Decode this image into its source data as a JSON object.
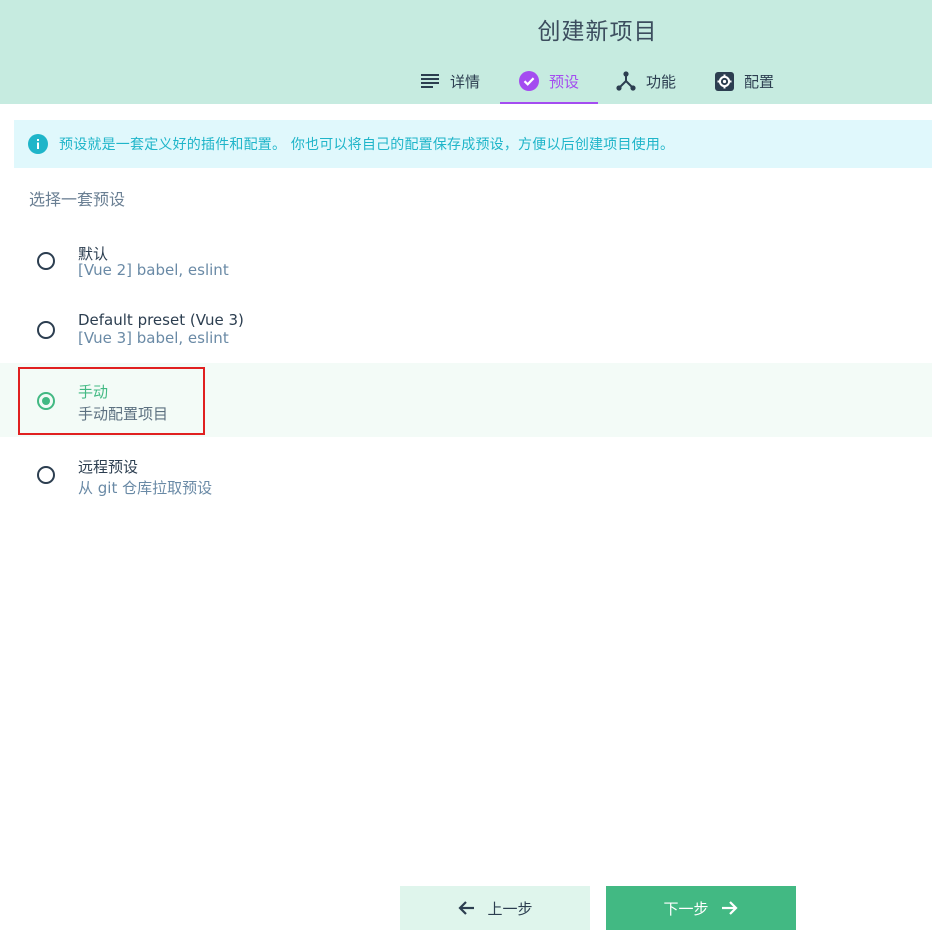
{
  "header": {
    "title": "创建新项目",
    "tabs": [
      {
        "label": "详情",
        "icon": "list-icon"
      },
      {
        "label": "预设",
        "icon": "check-circle-icon",
        "active": true
      },
      {
        "label": "功能",
        "icon": "fork-icon"
      },
      {
        "label": "配置",
        "icon": "gear-icon"
      }
    ]
  },
  "info": {
    "icon": "info-icon",
    "text": "预设就是一套定义好的插件和配置。 你也可以将自己的配置保存成预设，方便以后创建项目使用。"
  },
  "section_title": "选择一套预设",
  "presets": [
    {
      "name": "默认",
      "desc": "[Vue 2] babel, eslint",
      "selected": false
    },
    {
      "name": "Default preset (Vue 3)",
      "desc": "[Vue 3] babel, eslint",
      "selected": false
    },
    {
      "name": "手动",
      "desc": "手动配置项目",
      "selected": true
    },
    {
      "name": "远程预设",
      "desc": "从 git 仓库拉取预设",
      "selected": false
    }
  ],
  "buttons": {
    "prev_label": "上一步",
    "next_label": "下一步"
  },
  "colors": {
    "header_bg": "#c6ebe0",
    "accent_purple": "#a44cf0",
    "accent_green": "#42b983",
    "info_bg": "#e0f8fc",
    "info_text": "#1fb5c9",
    "highlight_border": "#e02020"
  }
}
